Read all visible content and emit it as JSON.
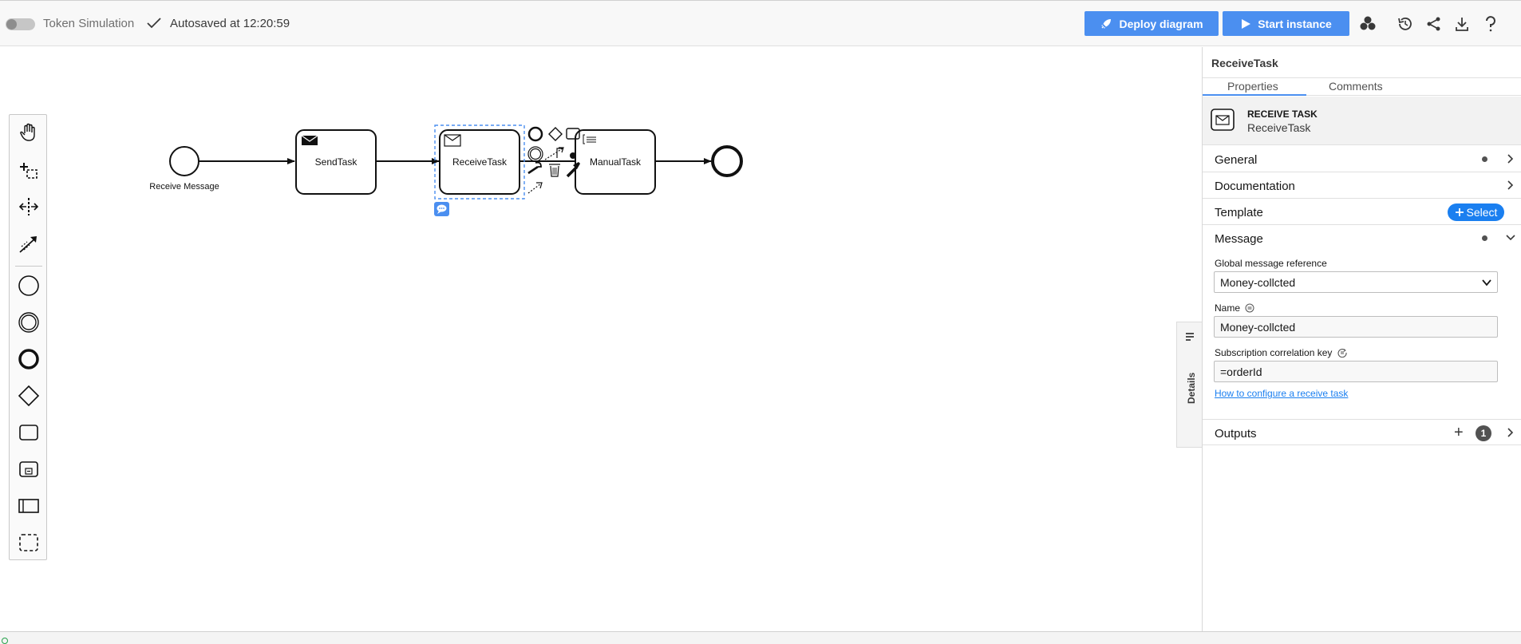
{
  "topbar": {
    "toggle_label": "Token Simulation",
    "autosave_text": "Autosaved at 12:20:59",
    "deploy_label": "Deploy diagram",
    "start_label": "Start instance"
  },
  "diagram": {
    "start_event_label": "Receive Message",
    "tasks": [
      {
        "name": "SendTask",
        "type": "send"
      },
      {
        "name": "ReceiveTask",
        "type": "receive",
        "selected": true
      },
      {
        "name": "ManualTask",
        "type": "manual"
      }
    ]
  },
  "details_tab": {
    "label": "Details"
  },
  "panel": {
    "title": "ReceiveTask",
    "tabs": [
      "Properties",
      "Comments"
    ],
    "element_type": "RECEIVE TASK",
    "element_name": "ReceiveTask",
    "groups": {
      "general": "General",
      "documentation": "Documentation",
      "template": "Template",
      "template_select": "Select",
      "message": "Message",
      "outputs": "Outputs",
      "outputs_count": "1"
    },
    "fields": {
      "global_message_label": "Global message reference",
      "global_message_value": "Money-collcted",
      "name_label": "Name",
      "name_value": "Money-collcted",
      "correlation_label": "Subscription correlation key",
      "correlation_value": "=orderId",
      "help_link": "How to configure a receive task"
    }
  },
  "colors": {
    "primary": "#4b8ff0",
    "select_badge": "#1a7ff0",
    "selection_outline": "#4b8ff0"
  }
}
